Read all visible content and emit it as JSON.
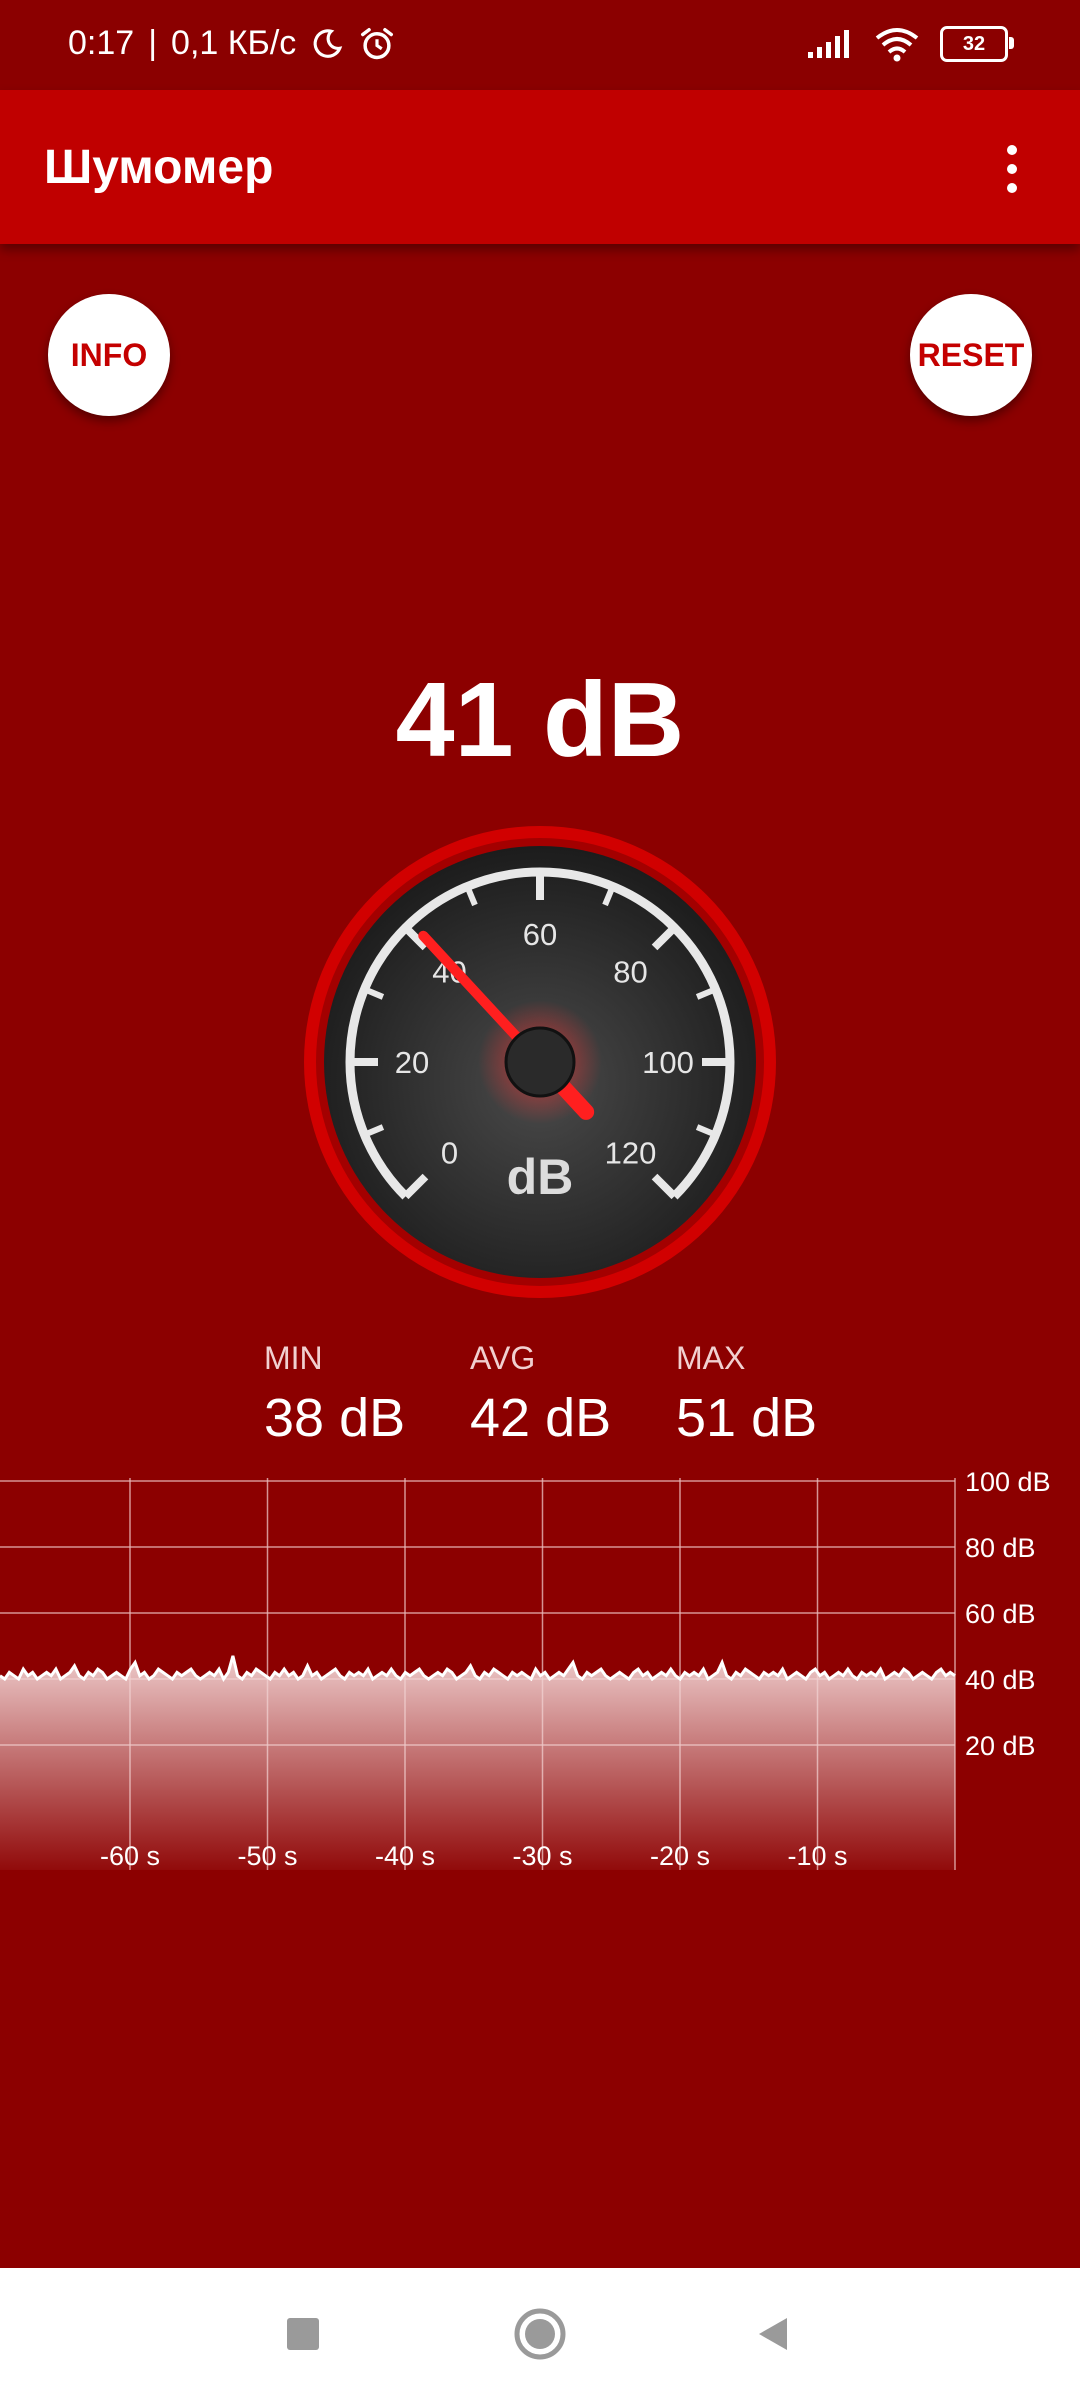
{
  "status_bar": {
    "time": "0:17",
    "network_speed": "0,1 КБ/с",
    "battery": "32",
    "icons": [
      "moon-icon",
      "alarm-icon",
      "signal-icon",
      "wifi-icon",
      "battery-icon"
    ]
  },
  "app_bar": {
    "title": "Шумомер",
    "menu_icon": "more-vert-icon"
  },
  "buttons": {
    "info": "INFO",
    "reset": "RESET"
  },
  "meter": {
    "current": "41 dB",
    "value": 41,
    "unit": "dB",
    "scale_labels": [
      "0",
      "20",
      "40",
      "60",
      "80",
      "100",
      "120"
    ]
  },
  "stats": {
    "min_label": "MIN",
    "min_value": "38 dB",
    "avg_label": "AVG",
    "avg_value": "42 dB",
    "max_label": "MAX",
    "max_value": "51 dB"
  },
  "chart_data": {
    "type": "area",
    "x_tick_labels": [
      "-60 s",
      "-50 s",
      "-40 s",
      "-30 s",
      "-20 s",
      "-10 s"
    ],
    "y_tick_labels": [
      "100 dB",
      "80 dB",
      "60 dB",
      "40 dB",
      "20 dB"
    ],
    "xlim": [
      -69,
      0
    ],
    "ylim": [
      0,
      110
    ],
    "grid": true,
    "series": [
      {
        "values": [
          41,
          40,
          42,
          41,
          40,
          43,
          41,
          42,
          40,
          41,
          42,
          41,
          43,
          40,
          41,
          42,
          44,
          41,
          40,
          42,
          41,
          43,
          42,
          40,
          41,
          42,
          41,
          40,
          43,
          45,
          41,
          42,
          40,
          41,
          43,
          42,
          41,
          40,
          42,
          41,
          42,
          43,
          41,
          40,
          41,
          42,
          41,
          43,
          40,
          42,
          47,
          41,
          40,
          42,
          41,
          43,
          42,
          41,
          40,
          42,
          41,
          43,
          41,
          42,
          40,
          41,
          44,
          41,
          42,
          40,
          41,
          42,
          43,
          41,
          40,
          42,
          41,
          42,
          41,
          43,
          40,
          41,
          42,
          41,
          43,
          41,
          40,
          42,
          41,
          42,
          43,
          41,
          40,
          41,
          42,
          41,
          43,
          42,
          40,
          41,
          42,
          44,
          41,
          40,
          42,
          41,
          43,
          42,
          41,
          40,
          42,
          41,
          42,
          41,
          40,
          43,
          41,
          42,
          40,
          41,
          42,
          41,
          43,
          45,
          41,
          40,
          42,
          41,
          42,
          43,
          41,
          40,
          41,
          42,
          41,
          40,
          42,
          43,
          41,
          42,
          40,
          41,
          42,
          41,
          43,
          41,
          40,
          42,
          41,
          42,
          41,
          43,
          40,
          41,
          42,
          45,
          41,
          40,
          42,
          41,
          43,
          42,
          41,
          40,
          42,
          41,
          42,
          41,
          43,
          40,
          41,
          42,
          41,
          40,
          42,
          43,
          41,
          42,
          40,
          41,
          42,
          41,
          43,
          41,
          40,
          42,
          41,
          42,
          41,
          43,
          40,
          41,
          42,
          41,
          43,
          42,
          40,
          41,
          42,
          41,
          40,
          42,
          43,
          41,
          42,
          41
        ]
      }
    ]
  },
  "nav_bar": {
    "icons": [
      "recents-square-icon",
      "home-circle-icon",
      "back-triangle-icon"
    ]
  }
}
